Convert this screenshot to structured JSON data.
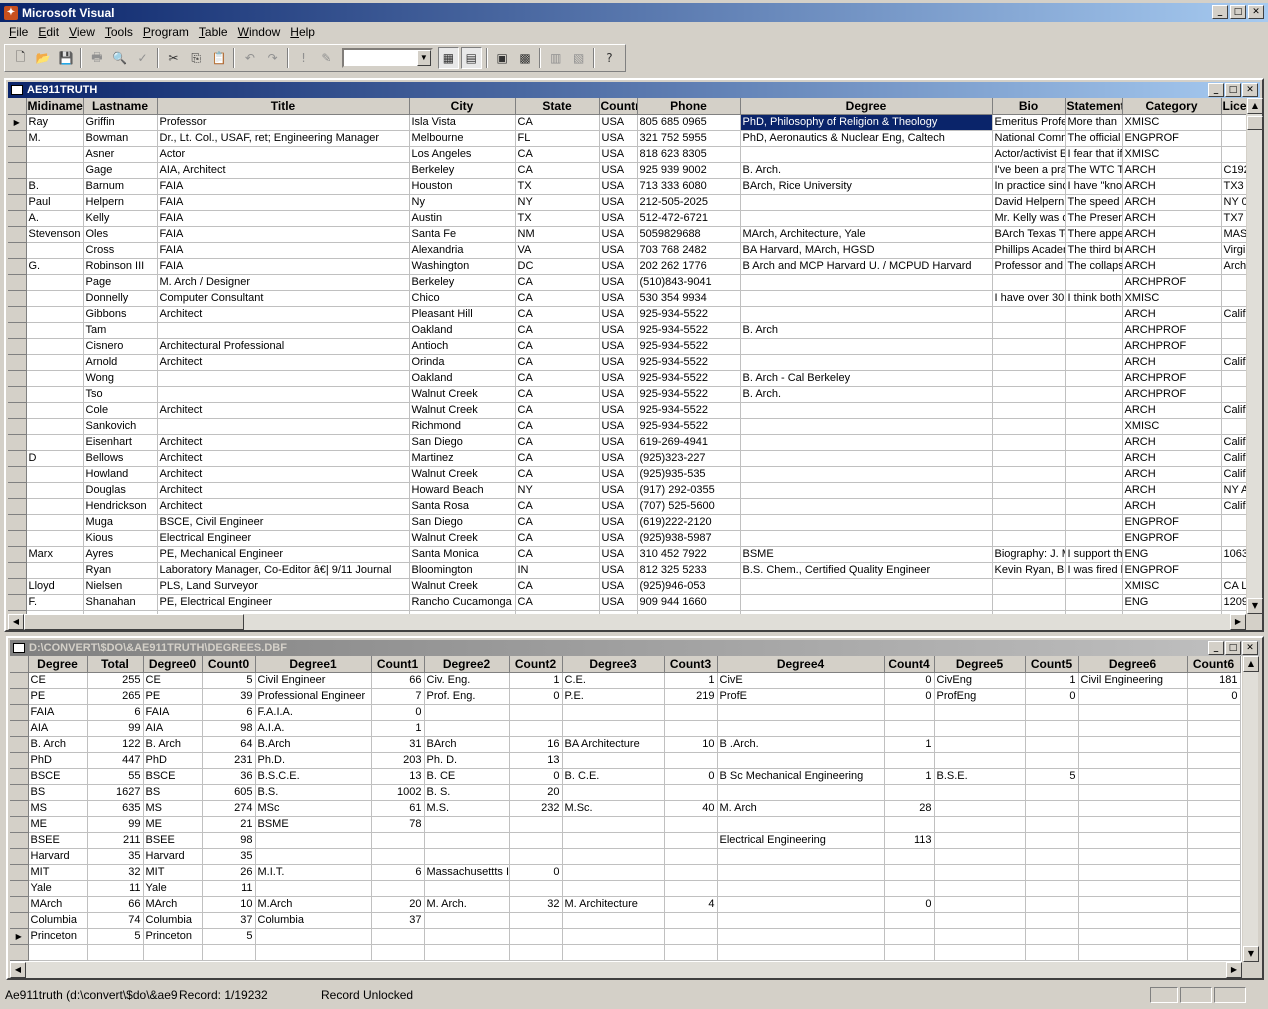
{
  "app": {
    "title": "Microsoft Visual",
    "icon": "fox-icon"
  },
  "menu": [
    "File",
    "Edit",
    "View",
    "Tools",
    "Program",
    "Table",
    "Window",
    "Help"
  ],
  "toolbar": {
    "combo_value": ""
  },
  "win1": {
    "title": "AE911TRUTH",
    "columns": [
      "Midiname",
      "Lastname",
      "Title",
      "City",
      "State",
      "Country",
      "Phone",
      "Degree",
      "Bio",
      "Statement",
      "Category",
      "License"
    ],
    "rows": [
      [
        "Ray",
        "Griffin",
        "Professor",
        "Isla Vista",
        "CA",
        "USA",
        "805 685 0965",
        "PhD, Philosophy of Religion & Theology",
        "Emeritus Professor",
        "More than",
        "XMISC",
        ""
      ],
      [
        "M.",
        "Bowman",
        "Dr., Lt. Col., USAF, ret; Engineering Manager",
        "Melbourne",
        "FL",
        "USA",
        "321 752 5955",
        "PhD, Aeronautics & Nuclear Eng, Caltech",
        "National Commission",
        "The official",
        "ENGPROF",
        ""
      ],
      [
        "",
        "Asner",
        "Actor",
        "Los Angeles",
        "CA",
        "USA",
        "818 623 8305",
        "",
        "Actor/activist Ed",
        "I fear that if",
        "XMISC",
        ""
      ],
      [
        "",
        "Gage",
        "AIA, Architect",
        "Berkeley",
        "CA",
        "USA",
        "925 939 9002",
        "B. Arch.",
        "I've been a practicing",
        "The WTC T",
        "ARCH",
        "C192"
      ],
      [
        "B.",
        "Barnum",
        "FAIA",
        "Houston",
        "TX",
        "USA",
        "713 333 6080",
        "BArch, Rice University",
        "In practice since",
        "I have \"kno",
        "ARCH",
        "TX3"
      ],
      [
        "Paul",
        "Helpern",
        "FAIA",
        "Ny",
        "NY",
        "USA",
        "212-505-2025",
        "",
        "David Helpern",
        "The speed",
        "ARCH",
        "NY 0"
      ],
      [
        "A.",
        "Kelly",
        "FAIA",
        "Austin",
        "TX",
        "USA",
        "512-472-6721",
        "",
        "Mr. Kelly was d",
        "The Presen",
        "ARCH",
        "TX7"
      ],
      [
        "Stevenson",
        "Oles",
        "FAIA",
        "Santa Fe",
        "NM",
        "USA",
        "5059829688",
        "MArch, Architecture, Yale",
        "BArch Texas Tech",
        "There appe",
        "ARCH",
        "MAS"
      ],
      [
        "",
        "Cross",
        "FAIA",
        "Alexandria",
        "VA",
        "USA",
        "703 768 2482",
        "BA Harvard, MArch, HGSD",
        "Phillips Academy",
        "The third bu",
        "ARCH",
        "Virgi"
      ],
      [
        "G.",
        "Robinson III",
        "FAIA",
        "Washington",
        "DC",
        "USA",
        "202 262 1776",
        "B Arch and MCP Harvard U. / MCPUD Harvard",
        "Professor and Dean",
        "The collaps",
        "ARCH",
        "Arch"
      ],
      [
        "",
        "Page",
        "M. Arch / Designer",
        "Berkeley",
        "CA",
        "USA",
        "(510)843-9041",
        "",
        "",
        "",
        "ARCHPROF",
        ""
      ],
      [
        "",
        "Donnelly",
        "Computer Consultant",
        "Chico",
        "CA",
        "USA",
        "530 354 9934",
        "",
        "I have over 30",
        "I think both",
        "XMISC",
        ""
      ],
      [
        "",
        "Gibbons",
        "Architect",
        "Pleasant Hill",
        "CA",
        "USA",
        "925-934-5522",
        "",
        "",
        "",
        "ARCH",
        "Calif."
      ],
      [
        "",
        "Tam",
        "",
        "Oakland",
        "CA",
        "USA",
        "925-934-5522",
        "B. Arch",
        "",
        "",
        "ARCHPROF",
        ""
      ],
      [
        "",
        "Cisnero",
        "Architectural Professional",
        "Antioch",
        "CA",
        "USA",
        "925-934-5522",
        "",
        "",
        "",
        "ARCHPROF",
        ""
      ],
      [
        "",
        "Arnold",
        "Architect",
        "Orinda",
        "CA",
        "USA",
        "925-934-5522",
        "",
        "",
        "",
        "ARCH",
        "Calif."
      ],
      [
        "",
        "Wong",
        "",
        "Oakland",
        "CA",
        "USA",
        "925-934-5522",
        "B. Arch - Cal Berkeley",
        "",
        "",
        "ARCHPROF",
        ""
      ],
      [
        "",
        "Tso",
        "",
        "Walnut Creek",
        "CA",
        "USA",
        "925-934-5522",
        "B. Arch.",
        "",
        "",
        "ARCHPROF",
        ""
      ],
      [
        "",
        "Cole",
        "Architect",
        "Walnut Creek",
        "CA",
        "USA",
        "925-934-5522",
        "",
        "",
        "",
        "ARCH",
        "Calif."
      ],
      [
        "",
        "Sankovich",
        "",
        "Richmond",
        "CA",
        "USA",
        "925-934-5522",
        "",
        "",
        "",
        "XMISC",
        ""
      ],
      [
        "",
        "Eisenhart",
        "Architect",
        "San Diego",
        "CA",
        "USA",
        "619-269-4941",
        "",
        "",
        "",
        "ARCH",
        "Calif."
      ],
      [
        "D",
        "Bellows",
        "Architect",
        "Martinez",
        "CA",
        "USA",
        "(925)323-227",
        "",
        "",
        "",
        "ARCH",
        "Calif."
      ],
      [
        "",
        "Howland",
        "Architect",
        "Walnut Creek",
        "CA",
        "USA",
        "(925)935-535",
        "",
        "",
        "",
        "ARCH",
        "Calif."
      ],
      [
        "",
        "Douglas",
        "Architect",
        "Howard Beach",
        "NY",
        "USA",
        "(917) 292-0355",
        "",
        "",
        "",
        "ARCH",
        "NY A"
      ],
      [
        "",
        "Hendrickson",
        "Architect",
        "Santa Rosa",
        "CA",
        "USA",
        "(707) 525-5600",
        "",
        "",
        "",
        "ARCH",
        "Calif."
      ],
      [
        "",
        "Muga",
        "BSCE, Civil Engineer",
        "San Diego",
        "CA",
        "USA",
        "(619)222-2120",
        "",
        "",
        "",
        "ENGPROF",
        ""
      ],
      [
        "",
        "Kious",
        "Electrical Engineer",
        "Walnut Creek",
        "CA",
        "USA",
        "(925)938-5987",
        "",
        "",
        "",
        "ENGPROF",
        ""
      ],
      [
        "Marx",
        "Ayres",
        "PE, Mechanical Engineer",
        "Santa Monica",
        "CA",
        "USA",
        "310 452 7922",
        "BSME",
        "Biography: J. M",
        "I support the",
        "ENG",
        "1063"
      ],
      [
        "",
        "Ryan",
        "Laboratory Manager, Co-Editor â€| 9/11 Journal",
        "Bloomington",
        "IN",
        "USA",
        "812 325 5233",
        "B.S. Chem., Certified Quality Engineer",
        "Kevin Ryan, B.S",
        "I was fired b",
        "ENGPROF",
        ""
      ],
      [
        "Lloyd",
        "Nielsen",
        "PLS, Land Surveyor",
        "Walnut Creek",
        "CA",
        "USA",
        "(925)946-053",
        "",
        "",
        "",
        "XMISC",
        "CA L"
      ],
      [
        "F.",
        "Shanahan",
        "PE, Electrical Engineer",
        "Rancho Cucamonga",
        "CA",
        "USA",
        "909 944 1660",
        "",
        "",
        "",
        "ENG",
        "1209"
      ]
    ]
  },
  "win2": {
    "title": "D:\\CONVERT\\$DO\\&AE911TRUTH\\DEGREES.DBF",
    "columns": [
      "Degree",
      "Total",
      "Degree0",
      "Count0",
      "Degree1",
      "Count1",
      "Degree2",
      "Count2",
      "Degree3",
      "Count3",
      "Degree4",
      "Count4",
      "Degree5",
      "Count5",
      "Degree6",
      "Count6"
    ],
    "rows": [
      [
        "CE",
        "255",
        "CE",
        "5",
        "Civil Engineer",
        "66",
        "Civ. Eng.",
        "1",
        "C.E.",
        "1",
        "CivE",
        "0",
        "CivEng",
        "1",
        "Civil Engineering",
        "181"
      ],
      [
        "PE",
        "265",
        "PE",
        "39",
        "Professional Engineer",
        "7",
        "Prof. Eng.",
        "0",
        "P.E.",
        "219",
        "ProfE",
        "0",
        "ProfEng",
        "0",
        "",
        "0"
      ],
      [
        "FAIA",
        "6",
        "FAIA",
        "6",
        "F.A.I.A.",
        "0",
        "",
        "",
        "",
        "",
        "",
        "",
        "",
        "",
        "",
        ""
      ],
      [
        "AIA",
        "99",
        "AIA",
        "98",
        "A.I.A.",
        "1",
        "",
        "",
        "",
        "",
        "",
        "",
        "",
        "",
        "",
        ""
      ],
      [
        "B. Arch",
        "122",
        "B. Arch",
        "64",
        "B.Arch",
        "31",
        "BArch",
        "16",
        "BA Architecture",
        "10",
        "B .Arch.",
        "1",
        "",
        "",
        "",
        ""
      ],
      [
        "PhD",
        "447",
        "PhD",
        "231",
        "Ph.D.",
        "203",
        "Ph. D.",
        "13",
        "",
        "",
        "",
        "",
        "",
        "",
        "",
        ""
      ],
      [
        "BSCE",
        "55",
        "BSCE",
        "36",
        "B.S.C.E.",
        "13",
        "B. CE",
        "0",
        "B. C.E.",
        "0",
        "B Sc Mechanical Engineering",
        "1",
        "B.S.E.",
        "5",
        "",
        ""
      ],
      [
        "BS",
        "1627",
        "BS",
        "605",
        "B.S.",
        "1002",
        "B. S.",
        "20",
        "",
        "",
        "",
        "",
        "",
        "",
        "",
        ""
      ],
      [
        "MS",
        "635",
        "MS",
        "274",
        "MSc",
        "61",
        "M.S.",
        "232",
        "M.Sc.",
        "40",
        "M. Arch",
        "28",
        "",
        "",
        "",
        ""
      ],
      [
        "ME",
        "99",
        "ME",
        "21",
        "BSME",
        "78",
        "",
        "",
        "",
        "",
        "",
        "",
        "",
        "",
        "",
        ""
      ],
      [
        "BSEE",
        "211",
        "BSEE",
        "98",
        "",
        "",
        "",
        "",
        "",
        "",
        "Electrical Engineering",
        "113",
        "",
        "",
        "",
        ""
      ],
      [
        "Harvard",
        "35",
        "Harvard",
        "35",
        "",
        "",
        "",
        "",
        "",
        "",
        "",
        "",
        "",
        "",
        "",
        ""
      ],
      [
        "MIT",
        "32",
        "MIT",
        "26",
        "M.I.T.",
        "6",
        "Massachusettts Institute",
        "0",
        "",
        "",
        "",
        "",
        "",
        "",
        "",
        ""
      ],
      [
        "Yale",
        "11",
        "Yale",
        "11",
        "",
        "",
        "",
        "",
        "",
        "",
        "",
        "",
        "",
        "",
        "",
        ""
      ],
      [
        "MArch",
        "66",
        "MArch",
        "10",
        "M.Arch",
        "20",
        "M. Arch.",
        "32",
        "M. Architecture",
        "4",
        "",
        "0",
        "",
        "",
        "",
        ""
      ],
      [
        "Columbia",
        "74",
        "Columbia",
        "37",
        "Columbia",
        "37",
        "",
        "",
        "",
        "",
        "",
        "",
        "",
        "",
        "",
        ""
      ],
      [
        "Princeton",
        "5",
        "Princeton",
        "5",
        "",
        "",
        "",
        "",
        "",
        "",
        "",
        "",
        "",
        "",
        "",
        ""
      ]
    ]
  },
  "status": {
    "file": "Ae911truth (d:\\convert\\$do\\&ae911tru",
    "record": "Record: 1/19232",
    "lock": "Record Unlocked"
  }
}
